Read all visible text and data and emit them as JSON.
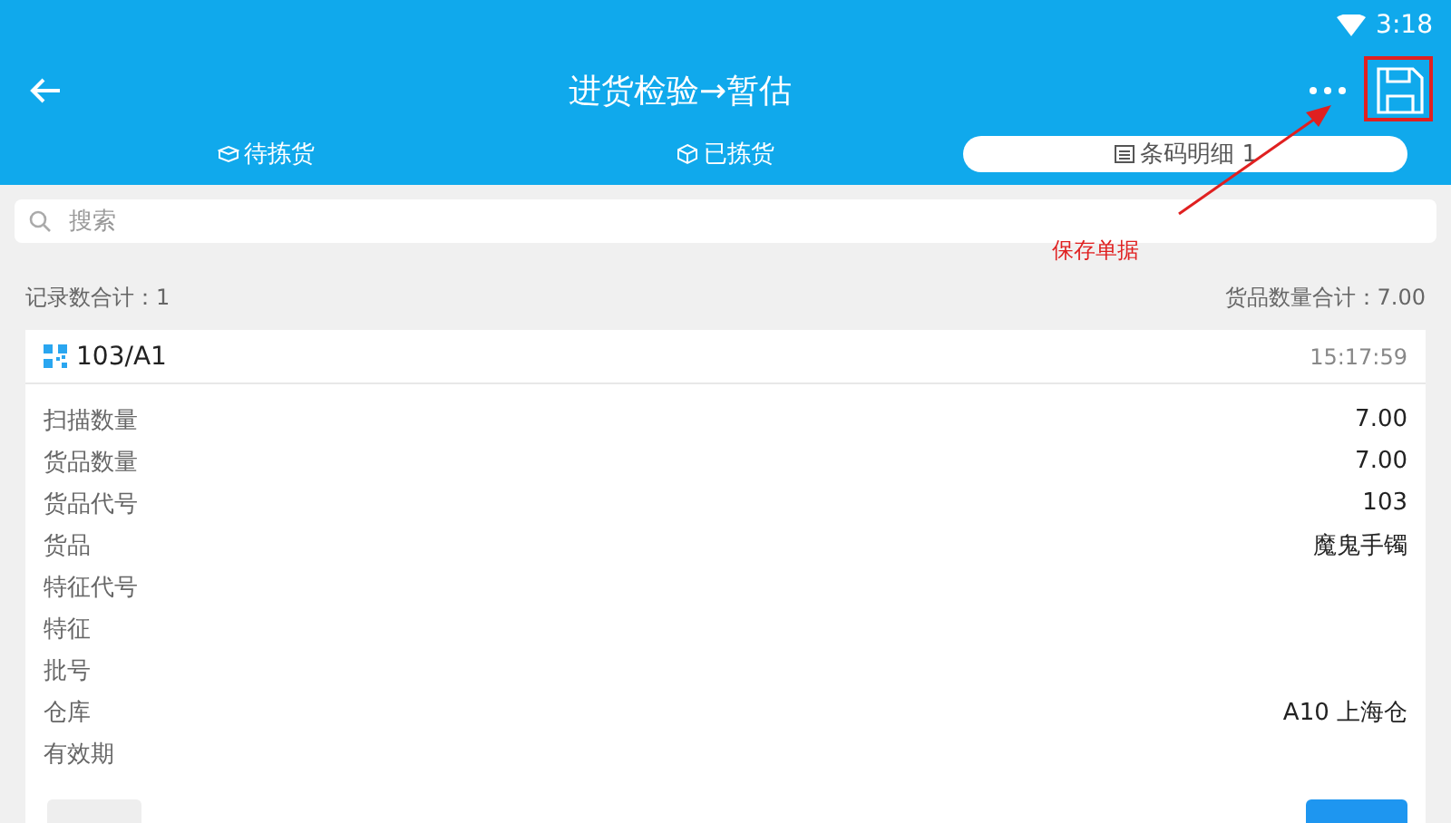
{
  "status_bar": {
    "time": "3:18"
  },
  "header": {
    "title": "进货检验→暂估"
  },
  "tabs": [
    {
      "label": "待拣货",
      "selected": false,
      "kind": "box"
    },
    {
      "label": "已拣货",
      "selected": false,
      "kind": "cube"
    },
    {
      "label": "条码明细 1",
      "selected": true,
      "kind": "list"
    }
  ],
  "search": {
    "placeholder": "搜索"
  },
  "summary": {
    "records": "记录数合计：1",
    "quantity": "货品数量合计：7.00"
  },
  "card": {
    "code": "103/A1",
    "time": "15:17:59",
    "fields": [
      {
        "label": "扫描数量",
        "value": "7.00"
      },
      {
        "label": "货品数量",
        "value": "7.00"
      },
      {
        "label": "货品代号",
        "value": "103"
      },
      {
        "label": "货品",
        "value": "魔鬼手镯"
      },
      {
        "label": "特征代号"
      },
      {
        "label": "特征"
      },
      {
        "label": "批号"
      },
      {
        "label": "仓库",
        "value": "A10 上海仓"
      },
      {
        "label": "有效期"
      }
    ]
  },
  "annotation": {
    "text": "保存单据"
  }
}
